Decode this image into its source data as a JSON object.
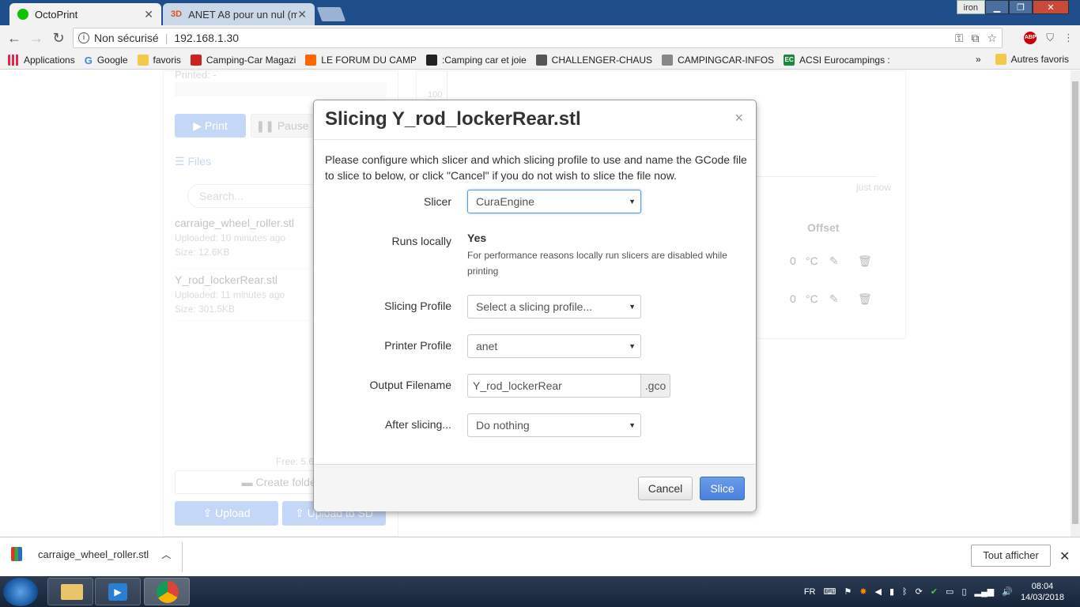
{
  "browser": {
    "tabs": [
      {
        "title": "OctoPrint",
        "active": true
      },
      {
        "title": "ANET A8 pour un nul (m",
        "active": false
      }
    ],
    "tab2_badge": "3D",
    "user": "iron",
    "security_label": "Non sécurisé",
    "url": "192.168.1.30"
  },
  "bookmarks": {
    "items": [
      "Applications",
      "Google",
      "favoris",
      "Camping-Car Magazi",
      "LE FORUM DU CAMP",
      ":Camping car et joie",
      "CHALLENGER-CHAUS",
      "CAMPINGCAR-INFOS",
      "ACSI Eurocampings :"
    ],
    "ec_badge": "EC",
    "more": "»",
    "others": "Autres favoris"
  },
  "background": {
    "printed": "Printed: -",
    "print_btn": "Print",
    "pause_btn": "Pause",
    "files_title": "Files",
    "search_placeholder": "Search...",
    "files": [
      {
        "name": "carraige_wheel_roller.stl",
        "uploaded": "Uploaded: 10 minutes ago",
        "size": "Size: 12.6KB"
      },
      {
        "name": "Y_rod_lockerRear.stl",
        "uploaded": "Uploaded: 11 minutes ago",
        "size": "Size: 301.5KB"
      }
    ],
    "free": "Free: 5.6",
    "create_folder": "Create folder",
    "upload": "Upload",
    "upload_sd": "Upload to SD",
    "chart_tick": "100",
    "just_now": "just now",
    "offset_header": "Offset",
    "offset_rows": [
      {
        "value": "0",
        "unit": "°C"
      },
      {
        "value": "0",
        "unit": "°C"
      }
    ]
  },
  "modal": {
    "title": "Slicing Y_rod_lockerRear.stl",
    "close": "×",
    "intro": "Please configure which slicer and which slicing profile to use and name the GCode file to slice to below, or click \"Cancel\" if you do not wish to slice the file now.",
    "slicer_label": "Slicer",
    "slicer_value": "CuraEngine",
    "runs_label": "Runs locally",
    "runs_value": "Yes",
    "runs_note": "For performance reasons locally run slicers are disabled while printing",
    "profile_label": "Slicing Profile",
    "profile_value": "Select a slicing profile...",
    "printer_label": "Printer Profile",
    "printer_value": "anet",
    "output_label": "Output Filename",
    "output_value": "Y_rod_lockerRear",
    "output_ext": ".gco",
    "after_label": "After slicing...",
    "after_value": "Do nothing",
    "cancel": "Cancel",
    "slice": "Slice"
  },
  "downloads": {
    "file": "carraige_wheel_roller.stl",
    "show_all": "Tout afficher",
    "close": "✕"
  },
  "taskbar": {
    "lang": "FR",
    "time": "08:04",
    "date": "14/03/2018"
  },
  "colors": {
    "accent": "#5b8ee6",
    "chrome_frame": "#1f4f8b"
  }
}
